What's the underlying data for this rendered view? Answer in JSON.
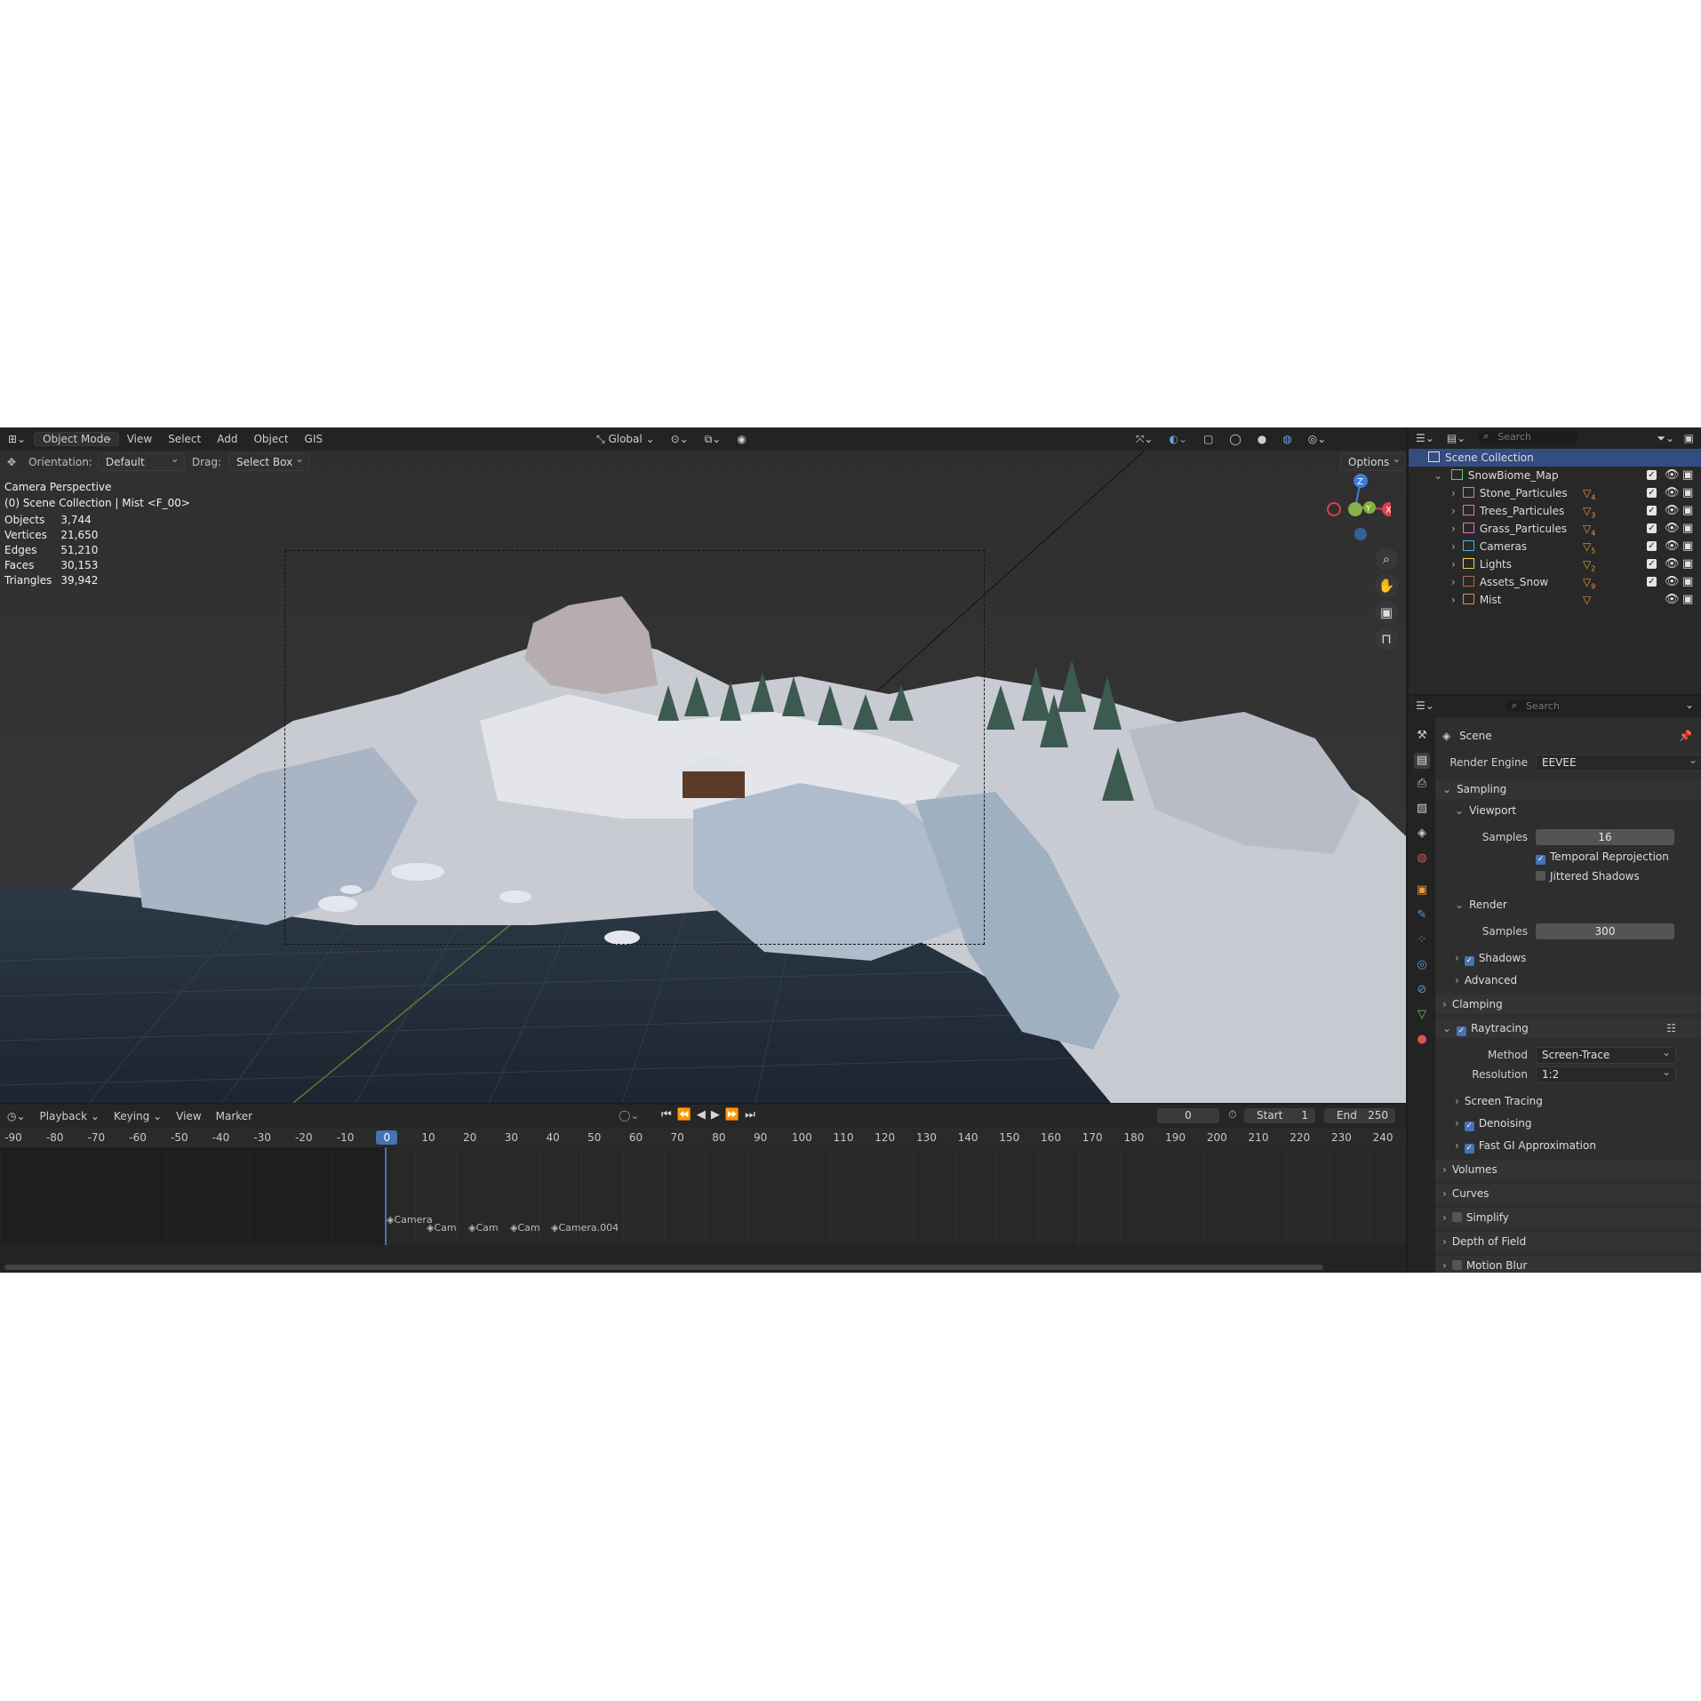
{
  "menu": {
    "mode": "Object Mode",
    "view": "View",
    "select": "Select",
    "add": "Add",
    "object": "Object",
    "gis": "GIS",
    "global": "Global"
  },
  "tools": {
    "orientation_label": "Orientation:",
    "orientation_value": "Default",
    "drag_label": "Drag:",
    "drag_value": "Select Box",
    "options": "Options"
  },
  "overlay": {
    "title": "Camera Perspective",
    "subtitle": "(0) Scene Collection | Mist <F_00>"
  },
  "stats": [
    {
      "label": "Objects",
      "value": "3,744"
    },
    {
      "label": "Vertices",
      "value": "21,650"
    },
    {
      "label": "Edges",
      "value": "51,210"
    },
    {
      "label": "Faces",
      "value": "30,153"
    },
    {
      "label": "Triangles",
      "value": "39,942"
    }
  ],
  "gizmo": {
    "z": "Z",
    "x": "X",
    "y": "Y"
  },
  "timeline": {
    "playback": "Playback",
    "keying": "Keying",
    "view": "View",
    "marker": "Marker",
    "current_frame": "0",
    "start_label": "Start",
    "start_value": "1",
    "end_label": "End",
    "end_value": "250",
    "ticks": [
      "-90",
      "-80",
      "-70",
      "-60",
      "-50",
      "-40",
      "-30",
      "-20",
      "-10",
      "0",
      "10",
      "20",
      "30",
      "40",
      "50",
      "60",
      "70",
      "80",
      "90",
      "100",
      "110",
      "120",
      "130",
      "140",
      "150",
      "160",
      "170",
      "180",
      "190",
      "200",
      "210",
      "220",
      "230",
      "240"
    ],
    "markers": [
      "Camera",
      "Cam",
      "Cam",
      "Cam",
      "Camera.004"
    ]
  },
  "outliner": {
    "search_placeholder": "Search",
    "scene_collection": "Scene Collection",
    "root": "SnowBiome_Map",
    "items": [
      {
        "name": "Stone_Particules",
        "count": "4",
        "color": "#e86fbe"
      },
      {
        "name": "Trees_Particules",
        "count": "3",
        "color": "#e86fbe"
      },
      {
        "name": "Grass_Particules",
        "count": "4",
        "color": "#e86fbe"
      },
      {
        "name": "Cameras",
        "count": "5",
        "color": "#4cb3e0"
      },
      {
        "name": "Lights",
        "count": "2",
        "color": "#f0d34c"
      },
      {
        "name": "Assets_Snow",
        "count": "9",
        "color": "#b06a4a"
      },
      {
        "name": "Mist",
        "count": "",
        "color": "#e0923a"
      }
    ]
  },
  "properties": {
    "search_placeholder": "Search",
    "scene": "Scene",
    "render_engine_label": "Render Engine",
    "render_engine_value": "EEVEE",
    "sampling": "Sampling",
    "viewport": "Viewport",
    "samples_label": "Samples",
    "viewport_samples": "16",
    "temporal_reprojection": "Temporal Reprojection",
    "jittered_shadows": "Jittered Shadows",
    "render": "Render",
    "render_samples": "300",
    "shadows": "Shadows",
    "advanced": "Advanced",
    "clamping": "Clamping",
    "raytracing": "Raytracing",
    "method_label": "Method",
    "method_value": "Screen-Trace",
    "resolution_label": "Resolution",
    "resolution_value": "1:2",
    "screen_tracing": "Screen Tracing",
    "denoising": "Denoising",
    "fast_gi": "Fast GI Approximation",
    "volumes": "Volumes",
    "curves": "Curves",
    "simplify": "Simplify",
    "depth_of_field": "Depth of Field",
    "motion_blur": "Motion Blur"
  },
  "colors": {
    "accent": "#4772b3",
    "selection": "#334d80"
  }
}
